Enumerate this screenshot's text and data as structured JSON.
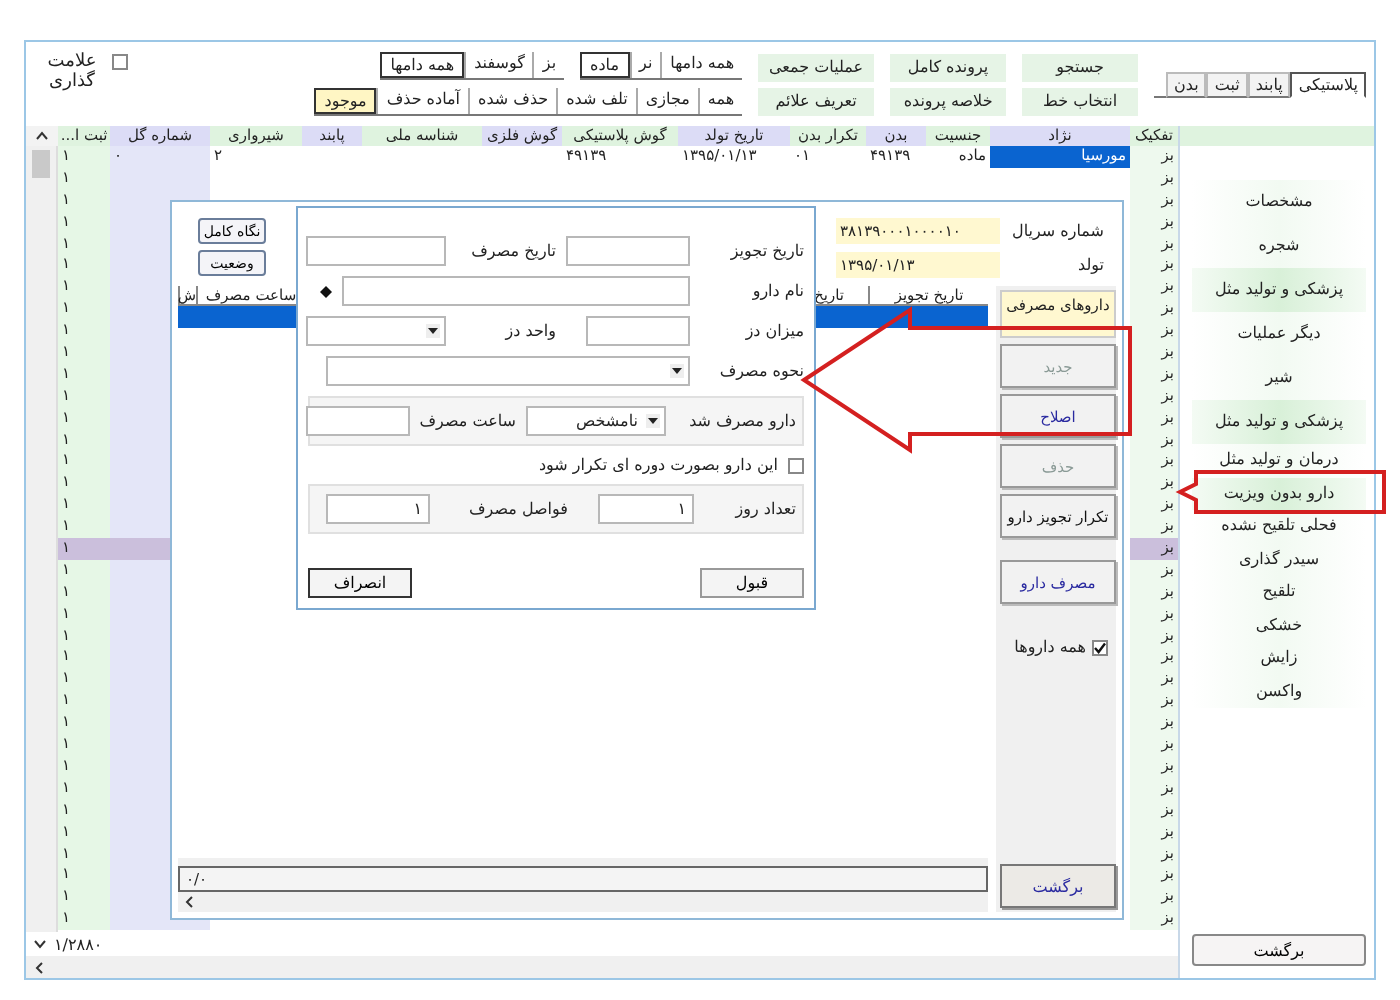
{
  "toolbar": {
    "view_tabs": [
      {
        "label": "پلاستیکی",
        "selected": true
      },
      {
        "label": "پابند",
        "selected": false
      },
      {
        "label": "ثبت",
        "selected": false
      },
      {
        "label": "بدن",
        "selected": false
      }
    ],
    "button_columns": [
      [
        "جستجو",
        "انتخاب خط"
      ],
      [
        "پرونده کامل",
        "خلاصه پرونده"
      ],
      [
        "عملیات جمعی",
        "تعریف علائم"
      ]
    ],
    "sex_filter": [
      {
        "label": "همه دامها",
        "selected": false
      },
      {
        "label": "نر",
        "selected": false
      },
      {
        "label": "ماده",
        "selected": true
      }
    ],
    "species_filter": [
      {
        "label": "بز",
        "selected": false
      },
      {
        "label": "گوسفند",
        "selected": false
      },
      {
        "label": "همه دامها",
        "selected": true
      }
    ],
    "status_filter": [
      {
        "label": "همه",
        "selected": false
      },
      {
        "label": "مجازی",
        "selected": false
      },
      {
        "label": "تلف شده",
        "selected": false
      },
      {
        "label": "حذف شده",
        "selected": false
      },
      {
        "label": "آماده حذف",
        "selected": false
      },
      {
        "label": "موجود",
        "selected": true
      }
    ],
    "marking": {
      "label": "علامت گذاری",
      "checked": false
    }
  },
  "table": {
    "columns": [
      "تفکیک",
      "نژاد",
      "جنسیت",
      "بدن",
      "تکرار بدن",
      "تاریخ تولد",
      "گوش پلاستیکی",
      "گوش فلزی",
      "شناسه ملی",
      "پابند",
      "شیرواری",
      "شماره گل",
      "ثبت ا..."
    ],
    "rows": [
      {
        "kind": "full",
        "cells": [
          {
            "text": "بز",
            "selected": false
          },
          {
            "text": "مورسیا",
            "selected": true
          },
          {
            "text": "ماده",
            "selected": false
          },
          {
            "text": "۴۹۱۳۹",
            "selected": false
          },
          {
            "text": "۰۱",
            "selected": false
          },
          {
            "text": "۱۳۹۵/۰۱/۱۳",
            "selected": false
          },
          {
            "text": "۴۹۱۳۹",
            "selected": false
          },
          {
            "selected": false
          },
          {
            "selected": false
          },
          {
            "selected": false
          },
          {
            "text": "۲",
            "selected": false
          },
          {
            "text": "۰",
            "selected": false
          },
          {
            "text": "۱",
            "selected": false
          }
        ]
      },
      {
        "kind": "partial",
        "tag": "بز",
        "register": "۱",
        "selected": false
      },
      {
        "kind": "partial",
        "tag": "بز",
        "register": "۱",
        "selected": false
      },
      {
        "kind": "partial",
        "tag": "بز",
        "register": "۱",
        "selected": false
      },
      {
        "kind": "partial",
        "tag": "بز",
        "register": "۱",
        "selected": false
      },
      {
        "kind": "partial",
        "tag": "بز",
        "register": "۱",
        "selected": false
      },
      {
        "kind": "partial",
        "tag": "بز",
        "register": "۱",
        "selected": false
      },
      {
        "kind": "partial",
        "tag": "بز",
        "register": "۱",
        "selected": false
      },
      {
        "kind": "partial",
        "tag": "بز",
        "register": "۱",
        "selected": false
      },
      {
        "kind": "partial",
        "tag": "بز",
        "register": "۱",
        "selected": false
      },
      {
        "kind": "partial",
        "tag": "بز",
        "register": "۱",
        "selected": false
      },
      {
        "kind": "partial",
        "tag": "بز",
        "register": "۱",
        "selected": false
      },
      {
        "kind": "partial",
        "tag": "بز",
        "register": "۱",
        "selected": false
      },
      {
        "kind": "partial",
        "tag": "بز",
        "register": "۱",
        "selected": false
      },
      {
        "kind": "partial",
        "tag": "بز",
        "register": "۱",
        "selected": false
      },
      {
        "kind": "partial",
        "tag": "بز",
        "register": "۱",
        "selected": false
      },
      {
        "kind": "partial",
        "tag": "بز",
        "register": "۱",
        "selected": false
      },
      {
        "kind": "partial",
        "tag": "بز",
        "register": "۱",
        "selected": false
      },
      {
        "kind": "partial",
        "tag": "بز",
        "register": "۱",
        "selected": true
      },
      {
        "kind": "partial",
        "tag": "بز",
        "register": "۱",
        "selected": false
      },
      {
        "kind": "partial",
        "tag": "بز",
        "register": "۱",
        "selected": false
      },
      {
        "kind": "partial",
        "tag": "بز",
        "register": "۱",
        "selected": false
      },
      {
        "kind": "partial",
        "tag": "بز",
        "register": "۱",
        "selected": false
      },
      {
        "kind": "partial",
        "tag": "بز",
        "register": "۱",
        "selected": false
      },
      {
        "kind": "partial",
        "tag": "بز",
        "register": "۱",
        "selected": false
      },
      {
        "kind": "partial",
        "tag": "بز",
        "register": "۱",
        "selected": false
      },
      {
        "kind": "partial",
        "tag": "بز",
        "register": "۱",
        "selected": false
      },
      {
        "kind": "partial",
        "tag": "بز",
        "register": "۱",
        "selected": false
      },
      {
        "kind": "partial",
        "tag": "بز",
        "register": "۱",
        "selected": false
      },
      {
        "kind": "partial",
        "tag": "بز",
        "register": "۱",
        "selected": false
      },
      {
        "kind": "partial",
        "tag": "بز",
        "register": "۱",
        "selected": false
      },
      {
        "kind": "partial",
        "tag": "بز",
        "register": "۱",
        "selected": false
      },
      {
        "kind": "partial",
        "tag": "بز",
        "register": "۱",
        "selected": false
      },
      {
        "kind": "partial",
        "tag": "بز",
        "register": "۱",
        "selected": false
      },
      {
        "kind": "partial",
        "tag": "بز",
        "register": "۱",
        "selected": false
      },
      {
        "kind": "partial",
        "tag": "بز",
        "register": "۱",
        "selected": false
      }
    ],
    "record_count": "۱/۲۸۸۰"
  },
  "side_menu": {
    "items": [
      {
        "label": "مشخصات",
        "highlighted": false
      },
      {
        "label": "شجره",
        "highlighted": false
      },
      {
        "label": "پزشکی و تولید مثل",
        "highlighted": true
      },
      {
        "label": "دیگر عملیات",
        "highlighted": false
      },
      {
        "label": "شیر",
        "highlighted": false
      },
      {
        "label": "پزشکی و تولید مثل",
        "highlighted": true
      },
      {
        "label": "درمان و تولید مثل",
        "highlighted": false
      },
      {
        "label": "دارو بدون ویزیت",
        "highlighted": true
      },
      {
        "label": "فحلی تلقیح نشده",
        "highlighted": false
      },
      {
        "label": "سیدر گذاری",
        "highlighted": false
      },
      {
        "label": "تلقیح",
        "highlighted": false
      },
      {
        "label": "خشکی",
        "highlighted": false
      },
      {
        "label": "زایش",
        "highlighted": false
      },
      {
        "label": "واکسن",
        "highlighted": false
      }
    ],
    "back_button": "برگشت"
  },
  "drug_window": {
    "serial_label": "شماره سریال",
    "serial": "۳۸۱۳۹۰۰۰۱۰۰۰۰۱۰",
    "birth_label": "تولد",
    "birth": "۱۳۹۵/۰۱/۱۳",
    "view_buttons": [
      "نگاه کامل",
      "وضعیت"
    ],
    "columns": [
      "تاریخ تجویز",
      "تاریخ",
      "ساعت مصرف",
      "ش"
    ],
    "list_label": "داروهای مصرفی",
    "actions": [
      {
        "label": "جدید",
        "disabled": true
      },
      {
        "label": "اصلاح",
        "disabled": false
      },
      {
        "label": "حذف",
        "disabled": true
      },
      {
        "label": "تکرار تجویز دارو",
        "disabled": false
      }
    ],
    "consume_button": "مصرف دارو",
    "all_drugs": {
      "label": "همه داروها",
      "checked": true
    },
    "back_button": "برگشت",
    "footer_value": "۰/۰"
  },
  "dialog": {
    "prescription_date": {
      "label": "تاریخ تجویز"
    },
    "consumption_date": {
      "label": "تاریخ مصرف"
    },
    "drug_name": {
      "label": "نام دارو"
    },
    "dose_amount": {
      "label": "میزان دز"
    },
    "dose_unit": {
      "label": "واحد دز"
    },
    "usage_method": {
      "label": "نحوه مصرف"
    },
    "consumed": {
      "label": "دارو مصرف شد",
      "value": "نامشخص"
    },
    "consumption_time": {
      "label": "ساعت مصرف"
    },
    "repeat": {
      "label": "این دارو بصورت دوره ای تکرار شود",
      "checked": false
    },
    "days": {
      "label": "تعداد روز",
      "value": "۱"
    },
    "interval": {
      "label": "فواصل مصرف",
      "value": "۱"
    },
    "ok_button": "قبول",
    "cancel_button": "انصراف"
  }
}
